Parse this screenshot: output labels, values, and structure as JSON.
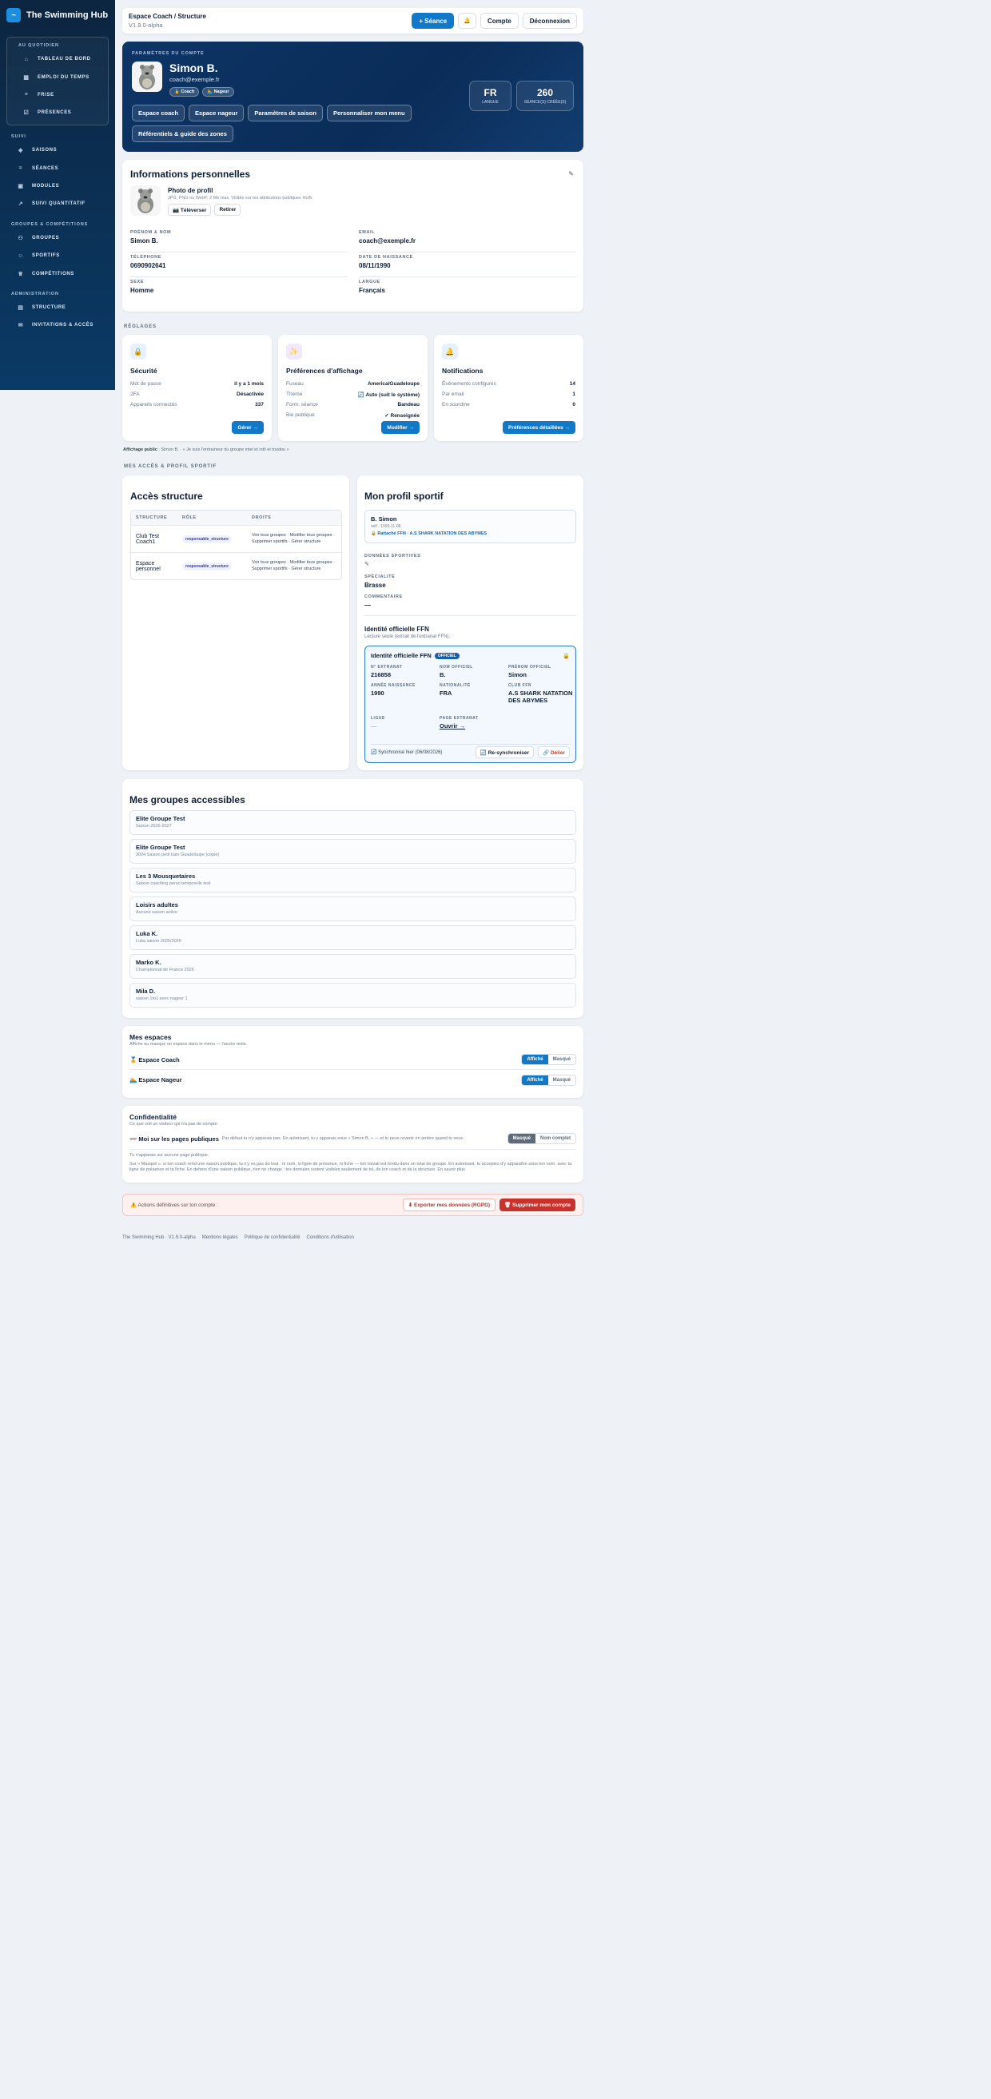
{
  "app": {
    "name": "The Swimming Hub",
    "logo_glyph": "~"
  },
  "sidebar": {
    "daily_title": "AU QUOTIDIEN",
    "daily": [
      {
        "icon": "home-icon",
        "glyph": "⌂",
        "label": "TABLEAU DE BORD"
      },
      {
        "icon": "calendar-icon",
        "glyph": "▦",
        "label": "EMPLOI DU TEMPS"
      },
      {
        "icon": "timeline-icon",
        "glyph": "≡",
        "label": "FRISE"
      },
      {
        "icon": "checklist-icon",
        "glyph": "☑",
        "label": "PRÉSENCES"
      }
    ],
    "sections": [
      {
        "title": "SUIVI",
        "items": [
          {
            "icon": "layers-icon",
            "glyph": "◈",
            "label": "SAISONS"
          },
          {
            "icon": "waves-icon",
            "glyph": "≈",
            "label": "SÉANCES"
          },
          {
            "icon": "grid-icon",
            "glyph": "▣",
            "label": "MODULES"
          },
          {
            "icon": "trend-icon",
            "glyph": "↗",
            "label": "SUIVI QUANTITATIF"
          }
        ]
      },
      {
        "title": "GROUPES & COMPÉTITIONS",
        "items": [
          {
            "icon": "users-icon",
            "glyph": "⚇",
            "label": "GROUPES"
          },
          {
            "icon": "user-icon",
            "glyph": "☺",
            "label": "SPORTIFS"
          },
          {
            "icon": "trophy-icon",
            "glyph": "♕",
            "label": "COMPÉTITIONS"
          }
        ]
      },
      {
        "title": "ADMINISTRATION",
        "items": [
          {
            "icon": "building-icon",
            "glyph": "▤",
            "label": "STRUCTURE"
          },
          {
            "icon": "mail-icon",
            "glyph": "✉",
            "label": "INVITATIONS & ACCÈS"
          }
        ]
      }
    ]
  },
  "topbar": {
    "title": "Espace Coach / Structure",
    "version": "V1.9.0-alpha",
    "new_session": "+ Séance",
    "bell": "🔔",
    "account": "Compte",
    "logout": "Déconnexion"
  },
  "hero": {
    "label": "PARAMÈTRES DU COMPTE",
    "name": "Simon B.",
    "email": "coach@exemple.fr",
    "chips": [
      "🏅 Coach",
      "🏊 Nageur"
    ],
    "buttons": [
      "Espace coach",
      "Espace nageur",
      "Paramètres de saison",
      "Personnaliser mon menu",
      "Référentiels & guide des zones"
    ],
    "stats": [
      {
        "value": "FR",
        "label": "LANGUE"
      },
      {
        "value": "260",
        "label": "SÉANCE(S) CRÉÉE(S)"
      }
    ]
  },
  "info": {
    "title": "Informations personnelles",
    "photo_title": "Photo de profil",
    "photo_hint": "JPG, PNG ou WebP, 2 Mo max. Visible sur tes attributions publiques HUB.",
    "upload": "📷 Téléverser",
    "remove": "Retirer",
    "fields": [
      {
        "label": "PRÉNOM & NOM",
        "value": "Simon B."
      },
      {
        "label": "EMAIL",
        "value": "coach@exemple.fr"
      },
      {
        "label": "TÉLÉPHONE",
        "value": "0690902641"
      },
      {
        "label": "DATE DE NAISSANCE",
        "value": "08/11/1990"
      },
      {
        "label": "SEXE",
        "value": "Homme"
      },
      {
        "label": "LANGUE",
        "value": "Français"
      }
    ]
  },
  "settings": {
    "heading": "RÉGLAGES",
    "cards": [
      {
        "icon": "lock-icon",
        "glyph": "🔒",
        "bg": "#e7f1fb",
        "title": "Sécurité",
        "rows": [
          [
            "Mot de passe",
            "il y a 1 mois"
          ],
          [
            "2FA",
            "Désactivée"
          ],
          [
            "Appareils connectés",
            "337"
          ]
        ],
        "button": "Gérer →"
      },
      {
        "icon": "sparkle-icon",
        "glyph": "✨",
        "bg": "#f1e9fb",
        "title": "Préférences d'affichage",
        "rows": [
          [
            "Fuseau",
            "America/Guadeloupe"
          ],
          [
            "Thème",
            "🔄 Auto (suit le système)"
          ],
          [
            "Form. séance",
            "Bandeau"
          ],
          [
            "Bio publique",
            "✓ Renseignée"
          ]
        ],
        "button": "Modifier →"
      },
      {
        "icon": "bell-icon",
        "glyph": "🔔",
        "bg": "#e7f1fb",
        "title": "Notifications",
        "rows": [
          [
            "Événements configurés",
            "14"
          ],
          [
            "Par email",
            "1"
          ],
          [
            "En sourdine",
            "0"
          ]
        ],
        "button": "Préférences détaillées →"
      }
    ],
    "public_prefix": "Affichage public",
    "public_text": " : Simon B. · « Je suis l'entraineur du groupe intel et intil et toudou »"
  },
  "access": {
    "heading": "MES ACCÈS & PROFIL SPORTIF",
    "title": "Accès structure",
    "columns": [
      "STRUCTURE",
      "RÔLE",
      "DROITS"
    ],
    "rows": [
      {
        "structure": "Club Test Coach1",
        "role": "responsable_structure",
        "rights": "Voir tous groupes · Modifier tous groupes · Supprimer sportifs · Gérer structure"
      },
      {
        "structure": "Espace personnel",
        "role": "responsable_structure",
        "rights": "Voir tous groupes · Modifier tous groupes · Supprimer sportifs · Gérer structure"
      }
    ]
  },
  "sport": {
    "title": "Mon profil sportif",
    "name": "B. Simon",
    "meta": "self · 1990-11-08",
    "club": "🔒 Rattaché FFN · A.S SHARK NATATION DES ABYMES",
    "data_label": "DONNÉES SPORTIVES",
    "spec_label": "SPÉCIALITÉ",
    "spec_value": "Brasse",
    "comment_label": "COMMENTAIRE",
    "comment_value": "—",
    "ffn_title": "Identité officielle FFN",
    "ffn_sub": "Lecture seule (extrait de l'extranat FFN).",
    "ffn_card_title": "Identité officielle FFN",
    "ffn_badge": "OFFICIEL",
    "ffn_fields": [
      {
        "label": "N° EXTRANAT",
        "value": "216858"
      },
      {
        "label": "NOM OFFICIEL",
        "value": "B."
      },
      {
        "label": "PRÉNOM OFFICIEL",
        "value": "Simon"
      },
      {
        "label": "ANNÉE NAISSANCE",
        "value": "1990"
      },
      {
        "label": "NATIONALITÉ",
        "value": "FRA"
      },
      {
        "label": "CLUB FFN",
        "value": "A.S SHARK NATATION DES ABYMES"
      },
      {
        "label": "LIGUE",
        "value": "—"
      },
      {
        "label": "PAGE EXTRANAT",
        "value": "Ouvrir →"
      }
    ],
    "sync": "🔄 Synchronisé hier (06/08/2026)",
    "resync": "🔄 Re-synchroniser",
    "unlink": "🔗 Délier"
  },
  "groups": {
    "title": "Mes groupes accessibles",
    "items": [
      {
        "name": "Elite Groupe Test",
        "sub": "Saison 2026-2027"
      },
      {
        "name": "Elite Groupe Test",
        "sub": "2024 Saison petit bain Guadeloupe (copie)"
      },
      {
        "name": "Les 3 Mousquetaires",
        "sub": "Saison coaching perso temporelle test"
      },
      {
        "name": "Loisirs adultes",
        "sub": "Aucune saison active"
      },
      {
        "name": "Luka K.",
        "sub": "Luka saison 2025/2026"
      },
      {
        "name": "Marko K.",
        "sub": "Championnat de France 2026"
      },
      {
        "name": "Mila D.",
        "sub": "saison 1to1 avec nageur 1"
      }
    ]
  },
  "spaces": {
    "title": "Mes espaces",
    "sub": "Affiche ou masque un espace dans le menu — l'accès reste.",
    "rows": [
      {
        "label": "🏅 Espace Coach",
        "on": "Affiché",
        "off": "Masqué"
      },
      {
        "label": "🏊 Espace Nageur",
        "on": "Affiché",
        "off": "Masqué"
      }
    ]
  },
  "privacy": {
    "title": "Confidentialité",
    "sub": "Ce que voit un visiteur qui n'a pas de compte.",
    "row_label": "👓 Moi sur les pages publiques",
    "row_note": "Par défaut tu n'y apparais pas. En autorisant, tu y apparais sous « Simon B. » — et tu peux revenir en arrière quand tu veux.",
    "opt_hidden": "Masqué",
    "opt_full": "Nom complet",
    "line1": "Tu n'apparais sur aucune page publique.",
    "line2": "Sur « Masqué », si ton coach rend une saison publique, tu n'y es pas du tout : ni nom, ni ligne de présence, ni fiche — ton travail est fondu dans un total de groupe. En autorisant, tu acceptes d'y apparaître sous ton nom, avec ta ligne de présence et ta fiche. En dehors d'une saison publique, rien ne change : tes données restent visibles seulement de toi, de ton coach et de la structure. En savoir plus"
  },
  "danger": {
    "text": "⚠️ Actions définitives sur ton compte :",
    "export": "⬇ Exporter mes données (RGPD)",
    "delete": "🗑 Supprimer mon compte"
  },
  "footer": [
    "The Swimming Hub · V1.9.0-alpha",
    "Mentions légales",
    "Politique de confidentialité",
    "Conditions d'utilisation"
  ]
}
